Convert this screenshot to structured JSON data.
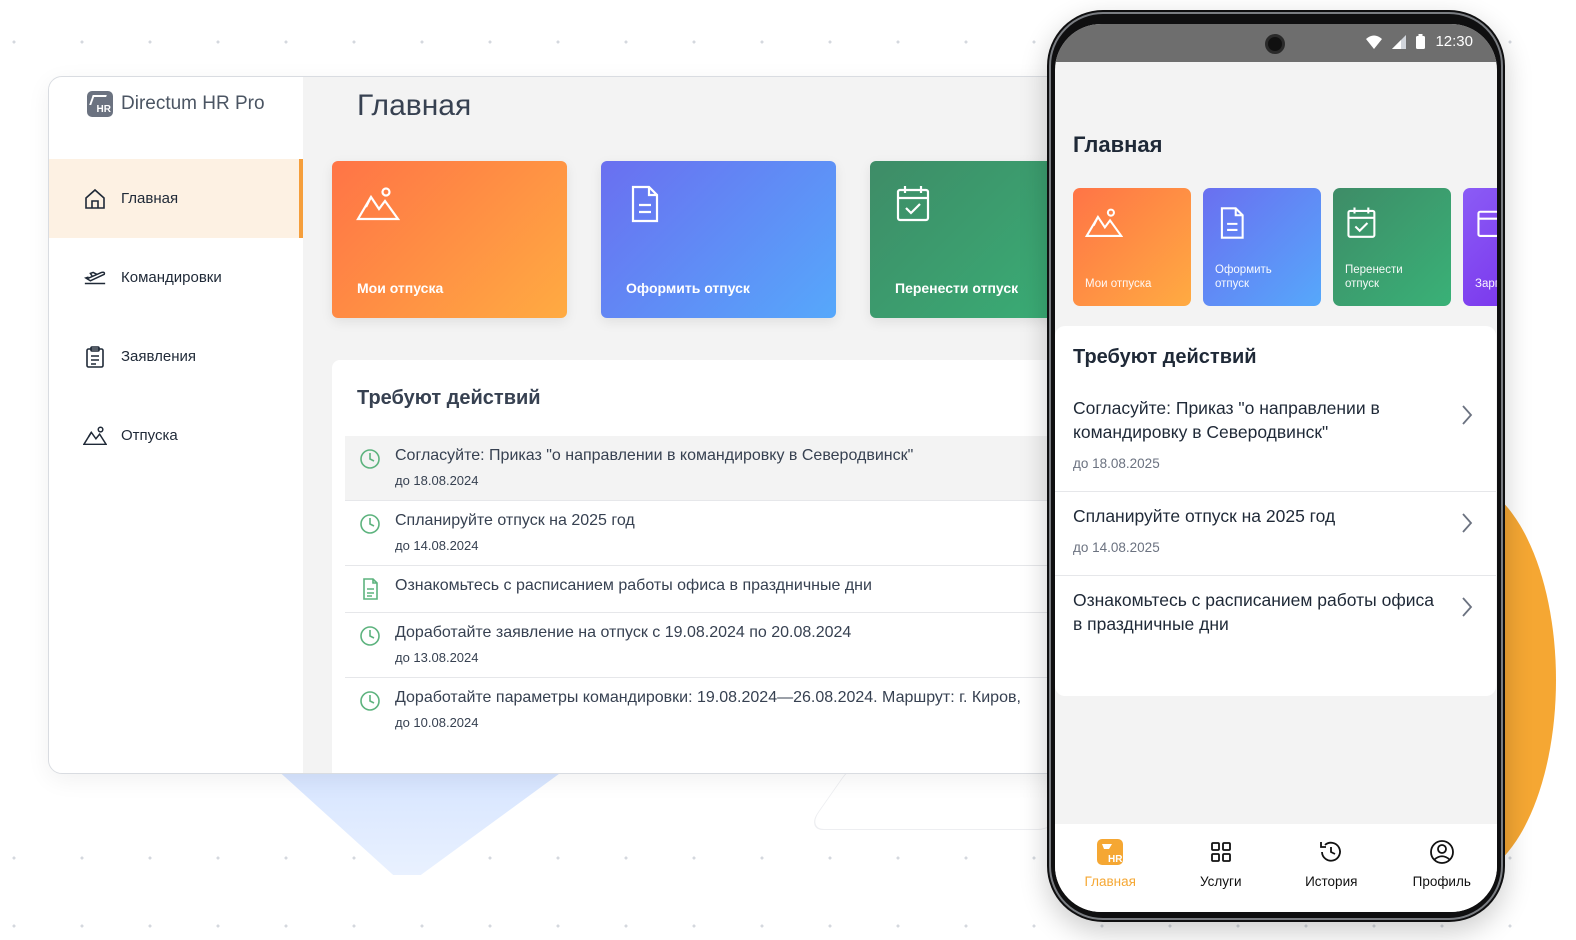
{
  "desktop": {
    "brand": "Directum HR Pro",
    "brand_badge": "HR",
    "page_title": "Главная",
    "nav": [
      {
        "label": "Главная",
        "icon": "home-icon",
        "active": true
      },
      {
        "label": "Командировки",
        "icon": "plane-icon",
        "active": false
      },
      {
        "label": "Заявления",
        "icon": "clipboard-icon",
        "active": false
      },
      {
        "label": "Отпуска",
        "icon": "mountain-icon",
        "active": false
      }
    ],
    "tiles": [
      {
        "label": "Мои отпуска",
        "icon": "mountain-icon",
        "color": "#ff8a45"
      },
      {
        "label": "Оформить отпуск",
        "icon": "document-icon",
        "color": "#5f8cf6"
      },
      {
        "label": "Перенести отпуск",
        "icon": "calendar-check-icon",
        "color": "#3c9f6f"
      }
    ],
    "tasks_title": "Требуют действий",
    "tasks": [
      {
        "text": "Согласуйте: Приказ \"о направлении в командировку в Северодвинск\"",
        "date": "до 18.08.2024",
        "icon": "clock-icon"
      },
      {
        "text": "Спланируйте отпуск на 2025 год",
        "date": "до 14.08.2024",
        "icon": "clock-icon"
      },
      {
        "text": "Ознакомьтесь с расписанием работы офиса в праздничные дни",
        "date": "",
        "icon": "document-icon"
      },
      {
        "text": "Доработайте заявление на отпуск с 19.08.2024 по 20.08.2024",
        "date": "до 13.08.2024",
        "icon": "clock-icon"
      },
      {
        "text": "Доработайте параметры командировки: 19.08.2024—26.08.2024. Маршрут: г. Киров,",
        "date": "до 10.08.2024",
        "icon": "clock-icon"
      }
    ]
  },
  "mobile": {
    "time": "12:30",
    "page_title": "Главная",
    "tiles": [
      {
        "label": "Мои отпуска",
        "icon": "mountain-icon"
      },
      {
        "label": "Оформить отпуск",
        "icon": "document-icon"
      },
      {
        "label": "Перенести отпуск",
        "icon": "calendar-check-icon"
      },
      {
        "label": "Зарп",
        "icon": "wallet-icon"
      }
    ],
    "tasks_title": "Требуют действий",
    "tasks": [
      {
        "text": "Согласуйте: Приказ \"о направлении в командировку в Северодвинск\"",
        "date": "до 18.08.2025"
      },
      {
        "text": "Спланируйте отпуск на 2025 год",
        "date": "до 14.08.2025"
      },
      {
        "text": "Ознакомьтесь с расписанием работы офиса в праздничные дни",
        "date": ""
      }
    ],
    "tabs": [
      {
        "label": "Главная",
        "icon": "hr-logo-icon",
        "active": true
      },
      {
        "label": "Услуги",
        "icon": "grid-icon",
        "active": false
      },
      {
        "label": "История",
        "icon": "history-icon",
        "active": false
      },
      {
        "label": "Профиль",
        "icon": "profile-icon",
        "active": false
      }
    ]
  },
  "colors": {
    "accent": "#f5a733",
    "active_nav_bg": "#fdf1e3",
    "status_bar": "#6e6e6e"
  }
}
